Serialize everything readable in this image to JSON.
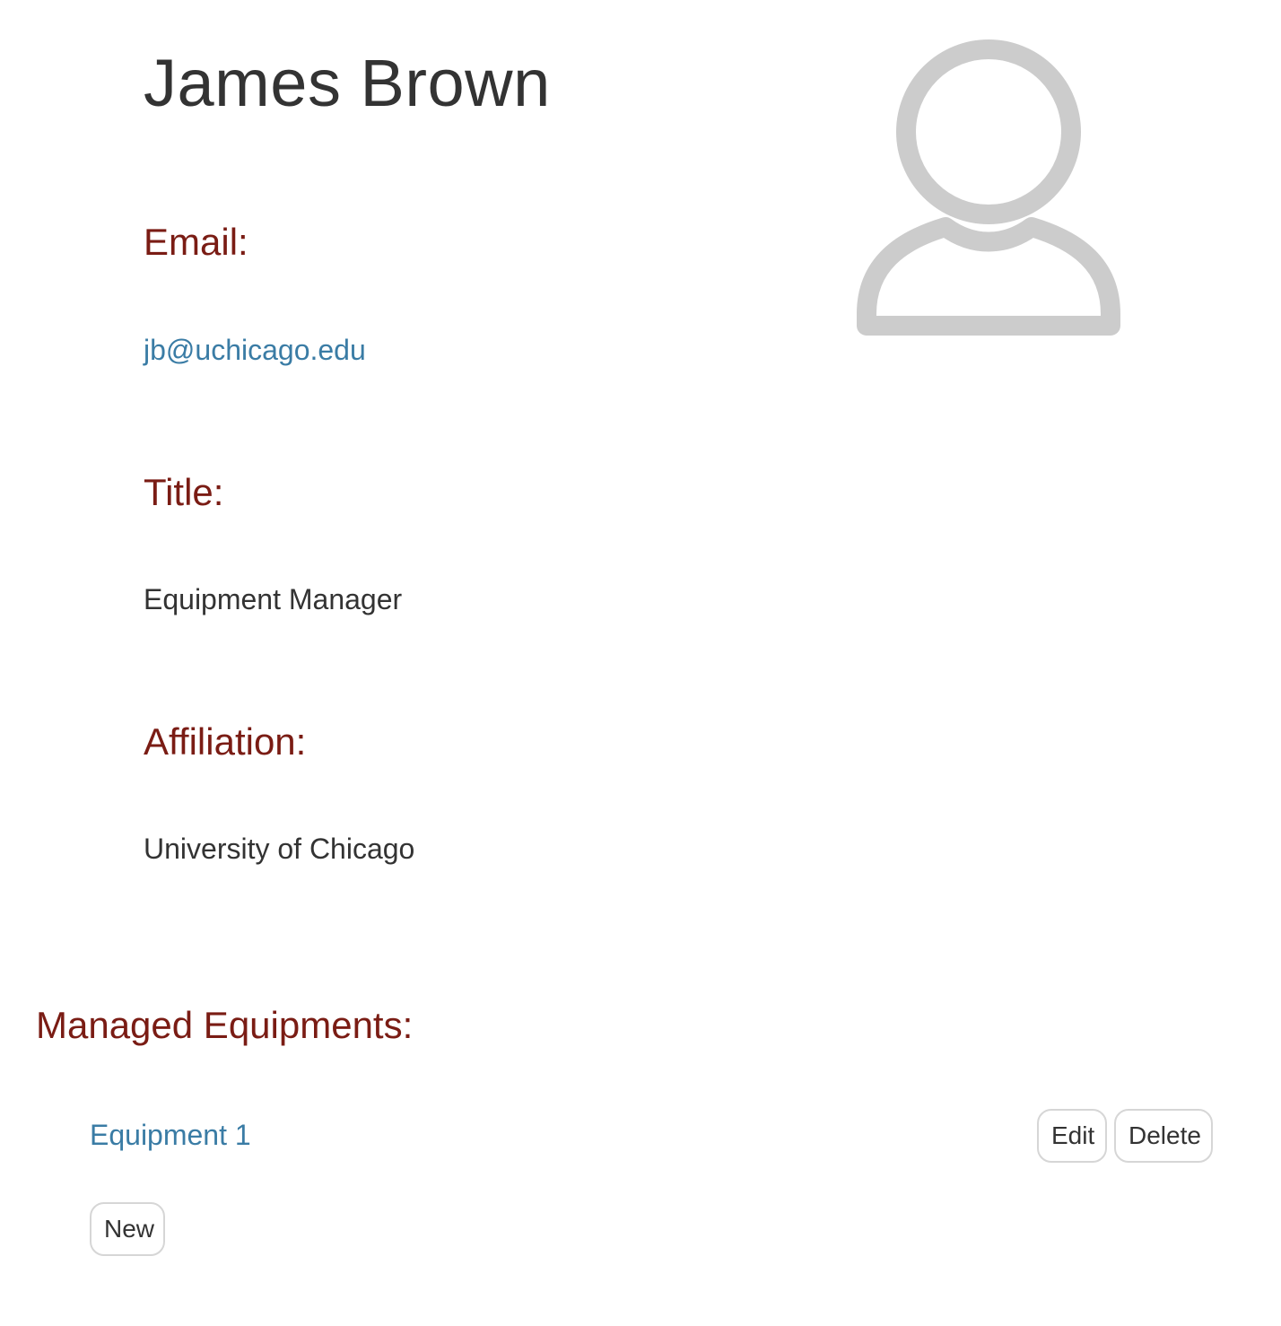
{
  "profile": {
    "name": "James Brown",
    "avatar_icon": "user-avatar-icon",
    "fields": {
      "email": {
        "label": "Email:",
        "value": "jb@uchicago.edu"
      },
      "title": {
        "label": "Title:",
        "value": "Equipment Manager"
      },
      "affiliation": {
        "label": "Affiliation:",
        "value": "University of Chicago"
      }
    }
  },
  "equipments": {
    "heading": "Managed Equipments:",
    "items": [
      {
        "name": "Equipment 1",
        "edit_label": "Edit",
        "delete_label": "Delete"
      }
    ],
    "new_label": "New"
  },
  "colors": {
    "label_color": "#7a1c14",
    "link_color": "#3a7ca5",
    "text_color": "#333333",
    "avatar_color": "#cccccc",
    "button_border": "#d6d6d6"
  }
}
